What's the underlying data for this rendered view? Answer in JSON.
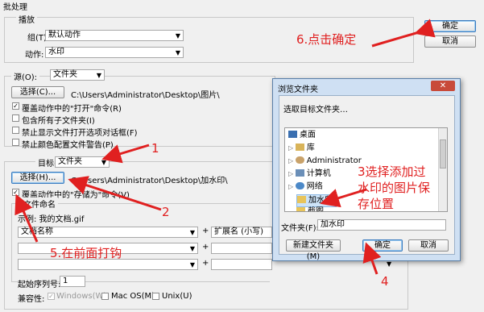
{
  "window": {
    "title": "批处理"
  },
  "play": {
    "legend": "播放",
    "group_label": "组(T):",
    "group_value": "默认动作",
    "action_label": "动作:",
    "action_value": "水印"
  },
  "source": {
    "label": "源(O):",
    "value": "文件夹",
    "choose_button": "选择(C)...",
    "path": "C:\\Users\\Administrator\\Desktop\\图片\\",
    "checkboxes": [
      {
        "label": "覆盖动作中的\"打开\"命令(R)",
        "checked": true
      },
      {
        "label": "包含所有子文件夹(I)",
        "checked": false
      },
      {
        "label": "禁止显示文件打开选项对话框(F)",
        "checked": false
      },
      {
        "label": "禁止颜色配置文件警告(P)",
        "checked": false
      }
    ]
  },
  "destination": {
    "label": "目标(D):",
    "value": "文件夹",
    "choose_button": "选择(H)...",
    "path": "C:\\Users\\Administrator\\Desktop\\加水印\\",
    "override_label": "覆盖动作中的\"存储为\"命令(V)",
    "override_checked": true,
    "naming_legend": "文件命名",
    "example": "示例: 我的文档.gif",
    "naming_rows": [
      {
        "left": "文档名称",
        "right": "扩展名 (小写)"
      },
      {
        "left": "",
        "right": ""
      },
      {
        "left": "",
        "right": ""
      }
    ],
    "serial_label": "起始序列号:",
    "serial_value": "1",
    "compat_label": "兼容性:",
    "compat_windows": "Windows(W)",
    "compat_mac": "Mac OS(M)",
    "compat_unix": "Unix(U)"
  },
  "side_buttons": {
    "ok": "确定",
    "cancel": "取消"
  },
  "browse_dialog": {
    "title": "浏览文件夹",
    "prompt": "选取目标文件夹…",
    "tree": [
      "桌面",
      "库",
      "Administrator",
      "计算机",
      "网络",
      "加水印",
      "截图"
    ],
    "folder_label": "文件夹(F):",
    "folder_value": "加水印",
    "new_folder": "新建文件夹(M)",
    "ok": "确定",
    "cancel": "取消"
  },
  "annotations": {
    "a1": "1",
    "a2": "2",
    "a3": "3选择添加过水印的图片保存位置",
    "a3_lines": [
      "3选择添加过",
      "水印的图片保",
      "存位置"
    ],
    "a4": "4",
    "a5": "5.在前面打钩",
    "a6": "6.点击确定"
  },
  "colors": {
    "annotation": "#e02020",
    "dialog_frame": "#cfe0f3"
  }
}
